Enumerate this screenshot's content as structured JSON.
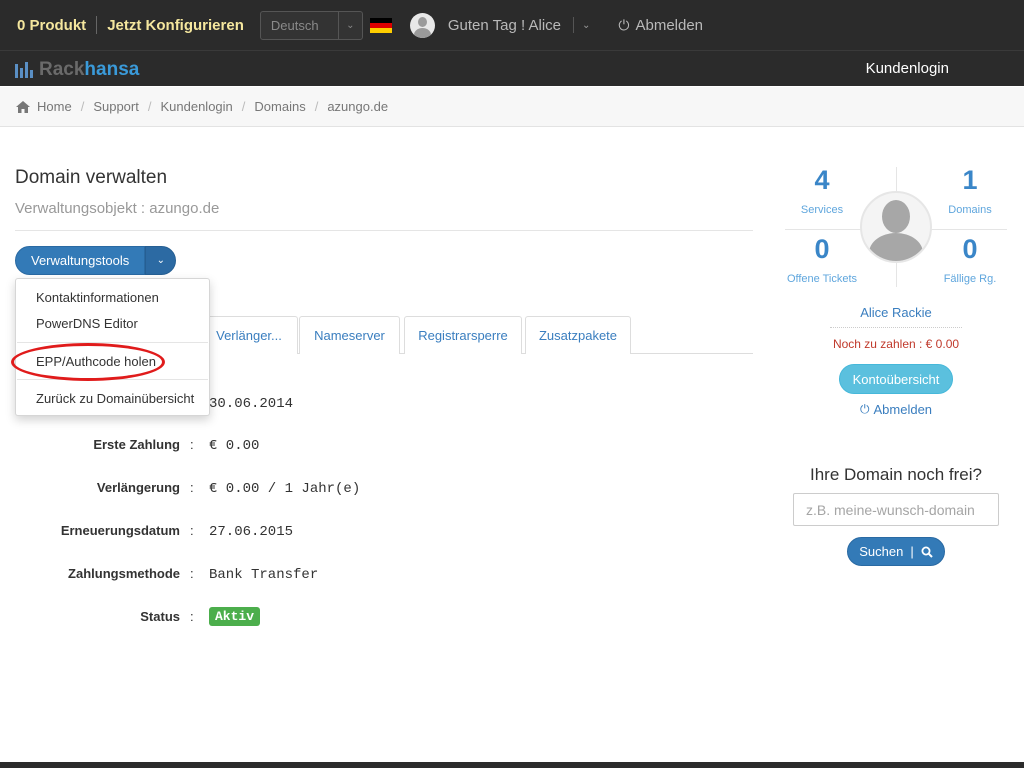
{
  "topbar": {
    "cart_label": "0 Produkt",
    "configure_label": "Jetzt Konfigurieren",
    "language": "Deutsch",
    "greeting": "Guten Tag ! Alice",
    "logout_label": "Abmelden"
  },
  "navbar": {
    "logo_part1": "Rack",
    "logo_part2": "hansa",
    "kundenlogin_label": "Kundenlogin"
  },
  "breadcrumb": [
    "Home",
    "Support",
    "Kundenlogin",
    "Domains",
    "azungo.de"
  ],
  "page": {
    "title": "Domain verwalten",
    "subtitle": "Verwaltungsobjekt : azungo.de"
  },
  "tools": {
    "button_label": "Verwaltungstools",
    "menu": [
      "Kontaktinformationen",
      "PowerDNS Editor",
      "EPP/Authcode holen",
      "Zurück zu Domainübersicht"
    ]
  },
  "tabs": [
    "Verlänger...",
    "Nameserver",
    "Registrarsperre",
    "Zusatzpakete"
  ],
  "details": {
    "first_value": "30.06.2014",
    "rows": [
      {
        "label": "Erste Zahlung",
        "value": "€ 0.00"
      },
      {
        "label": "Verlängerung",
        "value": "€ 0.00 / 1 Jahr(e)"
      },
      {
        "label": "Erneuerungsdatum",
        "value": "27.06.2015"
      },
      {
        "label": "Zahlungsmethode",
        "value": "Bank Transfer"
      },
      {
        "label": "Status",
        "value": "Aktiv"
      }
    ]
  },
  "sidebar": {
    "stats": [
      {
        "value": "4",
        "label": "Services"
      },
      {
        "value": "1",
        "label": "Domains"
      },
      {
        "value": "0",
        "label": "Offene Tickets"
      },
      {
        "value": "0",
        "label": "Fällige Rg."
      }
    ],
    "user_name": "Alice Rackie",
    "owed": "Noch zu zahlen : € 0.00",
    "account_button": "Kontoübersicht",
    "logout_label": "Abmelden"
  },
  "domain_search": {
    "heading": "Ihre Domain noch frei?",
    "placeholder": "z.B. meine-wunsch-domain",
    "button_label": "Suchen"
  },
  "colors": {
    "topbar_bg": "#2b2b2b",
    "brand_blue": "#337ab7",
    "info": "#5bc0de",
    "success": "#4cae4c",
    "danger": "#c0392b",
    "highlight_ellipse": "#e01b1b"
  },
  "icons": {
    "home": "home-icon",
    "power": "power-icon",
    "search": "search-icon",
    "chevron": "chevron-down-icon",
    "flag": "flag-de-icon"
  }
}
